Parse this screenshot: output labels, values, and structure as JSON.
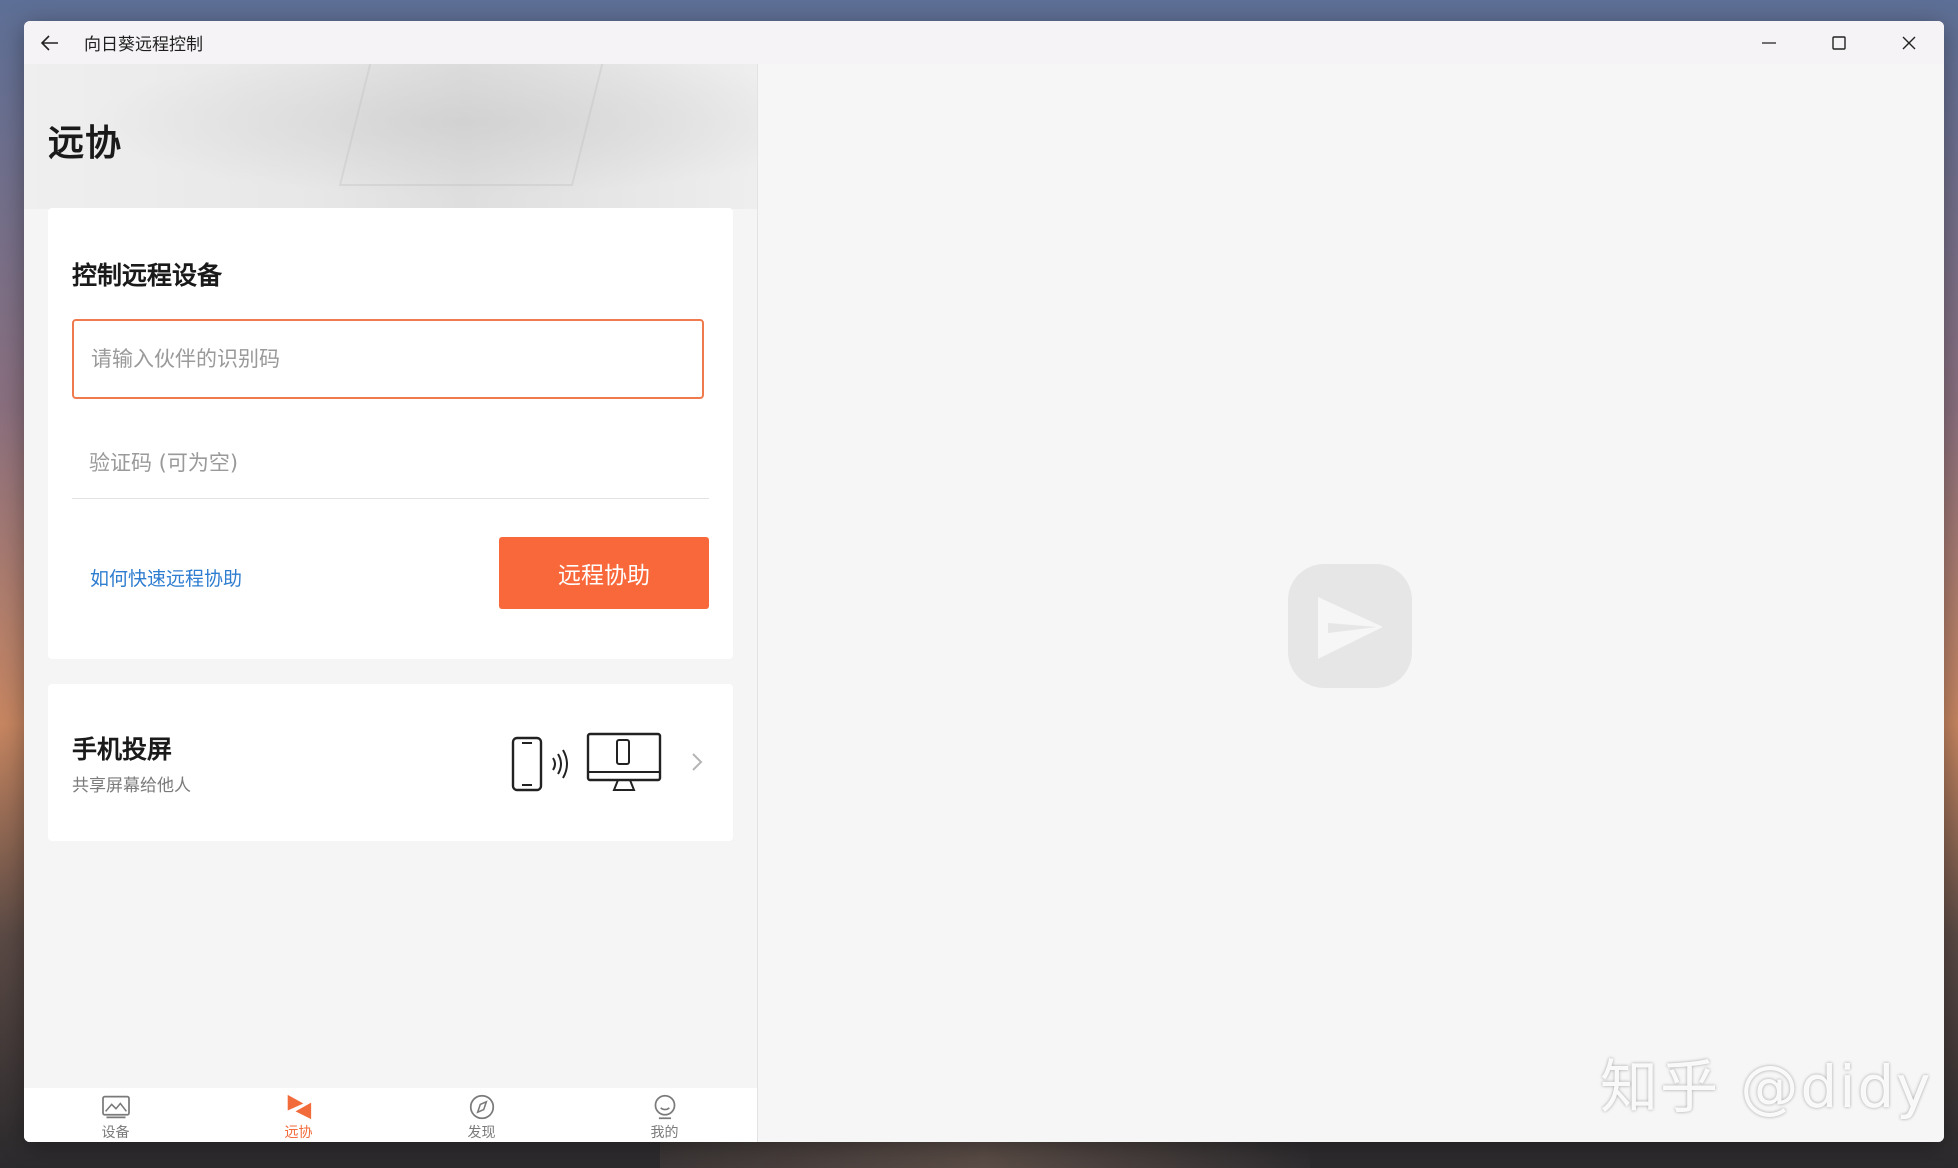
{
  "window": {
    "title": "向日葵远程控制"
  },
  "page": {
    "title": "远协"
  },
  "connect_card": {
    "title": "控制远程设备",
    "id_placeholder": "请输入伙伴的识别码",
    "id_value": "",
    "code_placeholder": "验证码 (可为空)",
    "code_value": "",
    "help_link": "如何快速远程协助",
    "connect_button": "远程协助"
  },
  "cast_card": {
    "title": "手机投屏",
    "subtitle": "共享屏幕给他人",
    "icon": "phone-to-monitor-icon"
  },
  "bottom_nav": {
    "items": [
      {
        "label": "设备",
        "icon": "device-icon",
        "active": false
      },
      {
        "label": "远协",
        "icon": "remote-assist-icon",
        "active": true
      },
      {
        "label": "发现",
        "icon": "compass-icon",
        "active": false
      },
      {
        "label": "我的",
        "icon": "profile-icon",
        "active": false
      }
    ]
  },
  "watermark": "知乎 @didy",
  "colors": {
    "accent": "#f9683a",
    "link": "#2e7dd0",
    "input_border": "#ee7a4d"
  }
}
